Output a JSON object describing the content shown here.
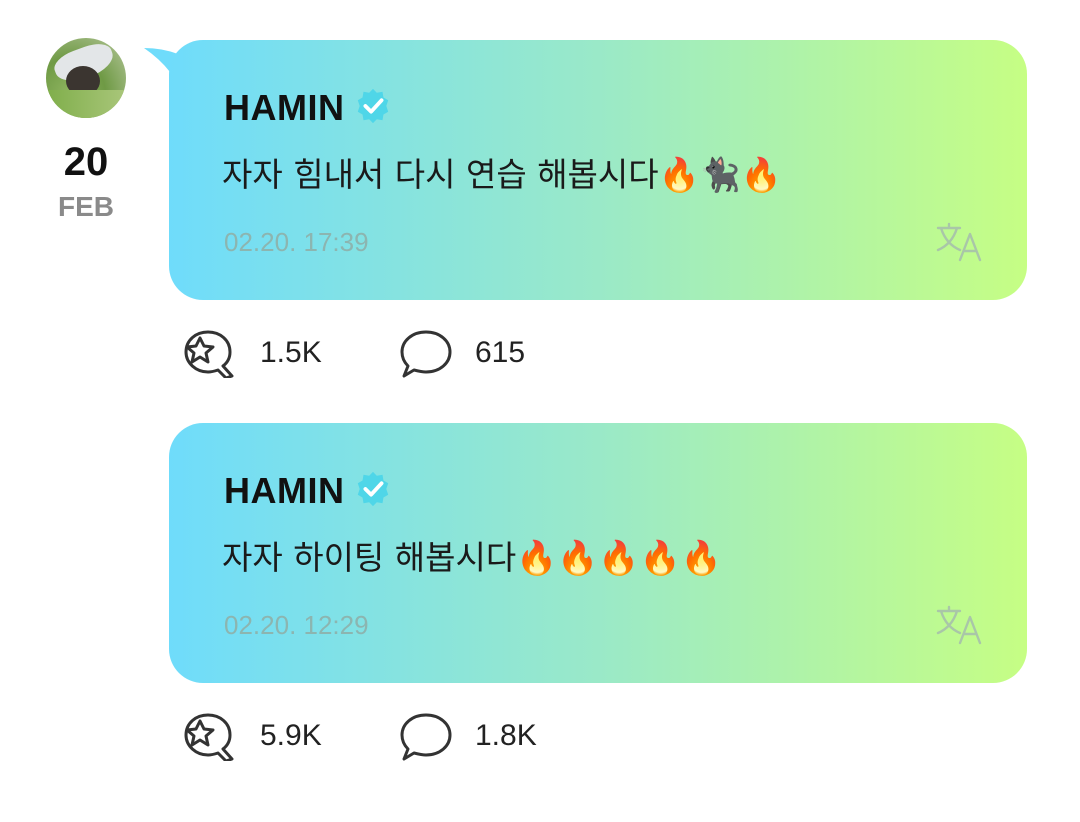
{
  "date": {
    "day": "20",
    "month": "FEB"
  },
  "posts": [
    {
      "author": "HAMIN",
      "message": "자자 힘내서 다시 연습 해봅시다🔥🐈‍⬛🔥",
      "time": "02.20. 17:39",
      "likes": "1.5K",
      "comments": "615"
    },
    {
      "author": "HAMIN",
      "message": "자자 하이팅 해봅시다🔥🔥🔥🔥🔥",
      "time": "02.20. 12:29",
      "likes": "5.9K",
      "comments": "1.8K"
    }
  ],
  "icons": {
    "verified": "verified-badge-icon",
    "translate": "translate-icon",
    "like": "like-icon",
    "comment": "comment-icon"
  },
  "colors": {
    "gradient_start": "#6fdcfb",
    "gradient_mid": "#9ae9c8",
    "gradient_end": "#c6fe84",
    "verified": "#4fd6e8",
    "timestamp": "#8cb5b0"
  }
}
